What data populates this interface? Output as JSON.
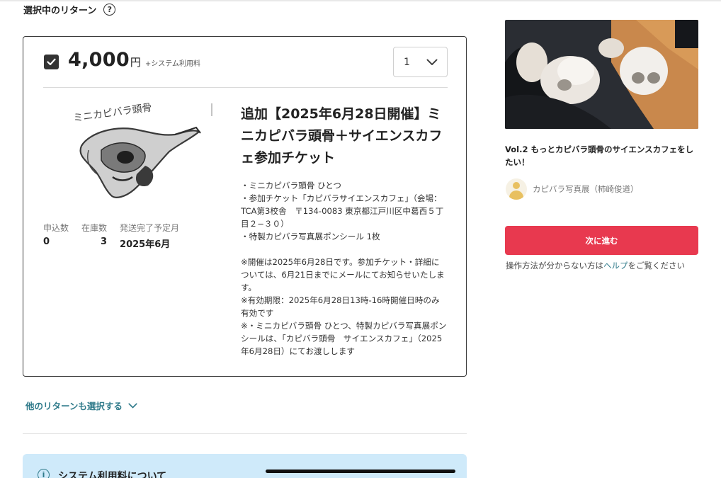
{
  "section": {
    "title": "選択中のリターン",
    "help_icon": "question-circle-icon"
  },
  "reward": {
    "checked": true,
    "price": "4,000",
    "currency": "円",
    "fee_note": "+システム利用料",
    "quantity": "1",
    "image_caption": "ミニカピバラ頭骨",
    "title": "追加【2025年6月28日開催】ミニカピバラ頭骨＋サイエンスカフェ参加チケット",
    "description": "・ミニカピバラ頭骨 ひとつ\n・参加チケット「カピバラサイエンスカフェ」（会場：TCA第3校舎　〒134-0083 東京都江戸川区中葛西５丁目２−３０）\n・特製カピバラ写真展ポンシール 1枚\n\n※開催は2025年6月28日です。参加チケット・詳細については、6月21日までにメールにてお知らせいたします。\n※有効期限：2025年6月28日13時-16時開催日時のみ有効です\n※・ミニカピバラ頭骨 ひとつ、特製カピバラ写真展ポンシールは、「カピバラ頭骨　サイエンスカフェ」（2025年6月28日）にてお渡しします",
    "stats": [
      {
        "label": "申込数",
        "value": "0"
      },
      {
        "label": "在庫数",
        "value": "3"
      },
      {
        "label": "発送完了予定月",
        "value": "2025年6月"
      }
    ]
  },
  "more_returns_link": "他のリターンも選択する",
  "info_box": {
    "title": "システム利用料について",
    "icon": "info-circle-icon"
  },
  "project": {
    "title": "Vol.2 もっとカピバラ頭骨のサイエンスカフェをしたい！",
    "owner": "カピバラ写真展（柿崎俊道）"
  },
  "next_button": "次に進む",
  "help": {
    "prefix": "操作方法が分からない方は",
    "link": "ヘルプ",
    "suffix": "をご覧ください"
  },
  "colors": {
    "accent": "#e8394f",
    "link": "#2f7a8a",
    "info_bg": "#cfeafa"
  }
}
